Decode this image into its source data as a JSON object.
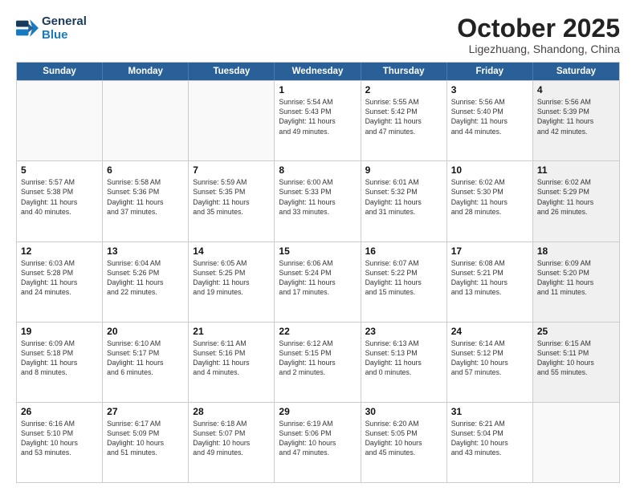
{
  "logo": {
    "line1": "General",
    "line2": "Blue"
  },
  "title": "October 2025",
  "location": "Ligezhuang, Shandong, China",
  "days_of_week": [
    "Sunday",
    "Monday",
    "Tuesday",
    "Wednesday",
    "Thursday",
    "Friday",
    "Saturday"
  ],
  "weeks": [
    [
      {
        "day": "",
        "info": "",
        "empty": true
      },
      {
        "day": "",
        "info": "",
        "empty": true
      },
      {
        "day": "",
        "info": "",
        "empty": true
      },
      {
        "day": "1",
        "info": "Sunrise: 5:54 AM\nSunset: 5:43 PM\nDaylight: 11 hours\nand 49 minutes."
      },
      {
        "day": "2",
        "info": "Sunrise: 5:55 AM\nSunset: 5:42 PM\nDaylight: 11 hours\nand 47 minutes."
      },
      {
        "day": "3",
        "info": "Sunrise: 5:56 AM\nSunset: 5:40 PM\nDaylight: 11 hours\nand 44 minutes."
      },
      {
        "day": "4",
        "info": "Sunrise: 5:56 AM\nSunset: 5:39 PM\nDaylight: 11 hours\nand 42 minutes.",
        "shaded": true
      }
    ],
    [
      {
        "day": "5",
        "info": "Sunrise: 5:57 AM\nSunset: 5:38 PM\nDaylight: 11 hours\nand 40 minutes."
      },
      {
        "day": "6",
        "info": "Sunrise: 5:58 AM\nSunset: 5:36 PM\nDaylight: 11 hours\nand 37 minutes."
      },
      {
        "day": "7",
        "info": "Sunrise: 5:59 AM\nSunset: 5:35 PM\nDaylight: 11 hours\nand 35 minutes."
      },
      {
        "day": "8",
        "info": "Sunrise: 6:00 AM\nSunset: 5:33 PM\nDaylight: 11 hours\nand 33 minutes."
      },
      {
        "day": "9",
        "info": "Sunrise: 6:01 AM\nSunset: 5:32 PM\nDaylight: 11 hours\nand 31 minutes."
      },
      {
        "day": "10",
        "info": "Sunrise: 6:02 AM\nSunset: 5:30 PM\nDaylight: 11 hours\nand 28 minutes."
      },
      {
        "day": "11",
        "info": "Sunrise: 6:02 AM\nSunset: 5:29 PM\nDaylight: 11 hours\nand 26 minutes.",
        "shaded": true
      }
    ],
    [
      {
        "day": "12",
        "info": "Sunrise: 6:03 AM\nSunset: 5:28 PM\nDaylight: 11 hours\nand 24 minutes."
      },
      {
        "day": "13",
        "info": "Sunrise: 6:04 AM\nSunset: 5:26 PM\nDaylight: 11 hours\nand 22 minutes."
      },
      {
        "day": "14",
        "info": "Sunrise: 6:05 AM\nSunset: 5:25 PM\nDaylight: 11 hours\nand 19 minutes."
      },
      {
        "day": "15",
        "info": "Sunrise: 6:06 AM\nSunset: 5:24 PM\nDaylight: 11 hours\nand 17 minutes."
      },
      {
        "day": "16",
        "info": "Sunrise: 6:07 AM\nSunset: 5:22 PM\nDaylight: 11 hours\nand 15 minutes."
      },
      {
        "day": "17",
        "info": "Sunrise: 6:08 AM\nSunset: 5:21 PM\nDaylight: 11 hours\nand 13 minutes."
      },
      {
        "day": "18",
        "info": "Sunrise: 6:09 AM\nSunset: 5:20 PM\nDaylight: 11 hours\nand 11 minutes.",
        "shaded": true
      }
    ],
    [
      {
        "day": "19",
        "info": "Sunrise: 6:09 AM\nSunset: 5:18 PM\nDaylight: 11 hours\nand 8 minutes."
      },
      {
        "day": "20",
        "info": "Sunrise: 6:10 AM\nSunset: 5:17 PM\nDaylight: 11 hours\nand 6 minutes."
      },
      {
        "day": "21",
        "info": "Sunrise: 6:11 AM\nSunset: 5:16 PM\nDaylight: 11 hours\nand 4 minutes."
      },
      {
        "day": "22",
        "info": "Sunrise: 6:12 AM\nSunset: 5:15 PM\nDaylight: 11 hours\nand 2 minutes."
      },
      {
        "day": "23",
        "info": "Sunrise: 6:13 AM\nSunset: 5:13 PM\nDaylight: 11 hours\nand 0 minutes."
      },
      {
        "day": "24",
        "info": "Sunrise: 6:14 AM\nSunset: 5:12 PM\nDaylight: 10 hours\nand 57 minutes."
      },
      {
        "day": "25",
        "info": "Sunrise: 6:15 AM\nSunset: 5:11 PM\nDaylight: 10 hours\nand 55 minutes.",
        "shaded": true
      }
    ],
    [
      {
        "day": "26",
        "info": "Sunrise: 6:16 AM\nSunset: 5:10 PM\nDaylight: 10 hours\nand 53 minutes."
      },
      {
        "day": "27",
        "info": "Sunrise: 6:17 AM\nSunset: 5:09 PM\nDaylight: 10 hours\nand 51 minutes."
      },
      {
        "day": "28",
        "info": "Sunrise: 6:18 AM\nSunset: 5:07 PM\nDaylight: 10 hours\nand 49 minutes."
      },
      {
        "day": "29",
        "info": "Sunrise: 6:19 AM\nSunset: 5:06 PM\nDaylight: 10 hours\nand 47 minutes."
      },
      {
        "day": "30",
        "info": "Sunrise: 6:20 AM\nSunset: 5:05 PM\nDaylight: 10 hours\nand 45 minutes."
      },
      {
        "day": "31",
        "info": "Sunrise: 6:21 AM\nSunset: 5:04 PM\nDaylight: 10 hours\nand 43 minutes."
      },
      {
        "day": "",
        "info": "",
        "empty": true,
        "shaded": true
      }
    ]
  ]
}
